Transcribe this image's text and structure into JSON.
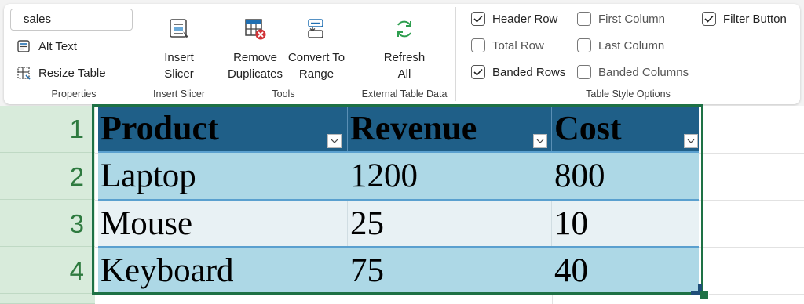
{
  "properties": {
    "table_name": "sales",
    "alt_text": "Alt Text",
    "resize_table": "Resize Table",
    "label": "Properties"
  },
  "insert_slicer_group": {
    "button_line1": "Insert",
    "button_line2": "Slicer",
    "label": "Insert Slicer"
  },
  "tools": {
    "remove_line1": "Remove",
    "remove_line2": "Duplicates",
    "convert_line1": "Convert To",
    "convert_line2": "Range",
    "label": "Tools"
  },
  "external": {
    "refresh_line1": "Refresh",
    "refresh_line2": "All",
    "label": "External Table Data"
  },
  "style_options": {
    "label": "Table Style Options",
    "header_row": {
      "label": "Header Row",
      "checked": true
    },
    "total_row": {
      "label": "Total Row",
      "checked": false
    },
    "banded_rows": {
      "label": "Banded Rows",
      "checked": true
    },
    "first_column": {
      "label": "First Column",
      "checked": false
    },
    "last_column": {
      "label": "Last Column",
      "checked": false
    },
    "banded_columns": {
      "label": "Banded Columns",
      "checked": false
    },
    "filter_button": {
      "label": "Filter Button",
      "checked": true
    }
  },
  "sheet": {
    "row_numbers": [
      "1",
      "2",
      "3",
      "4"
    ],
    "headers": [
      "Product",
      "Revenue",
      "Cost"
    ],
    "rows": [
      [
        "Laptop",
        "1200",
        "800"
      ],
      [
        "Mouse",
        "25",
        "10"
      ],
      [
        "Keyboard",
        "75",
        "40"
      ]
    ]
  },
  "colors": {
    "header_fill": "#1f5f88",
    "band_dark": "#add8e6",
    "band_light": "#e8f1f4",
    "selection": "#1e7145",
    "row_header": "#d8ebdb",
    "accent_green": "#2e7a3f"
  }
}
